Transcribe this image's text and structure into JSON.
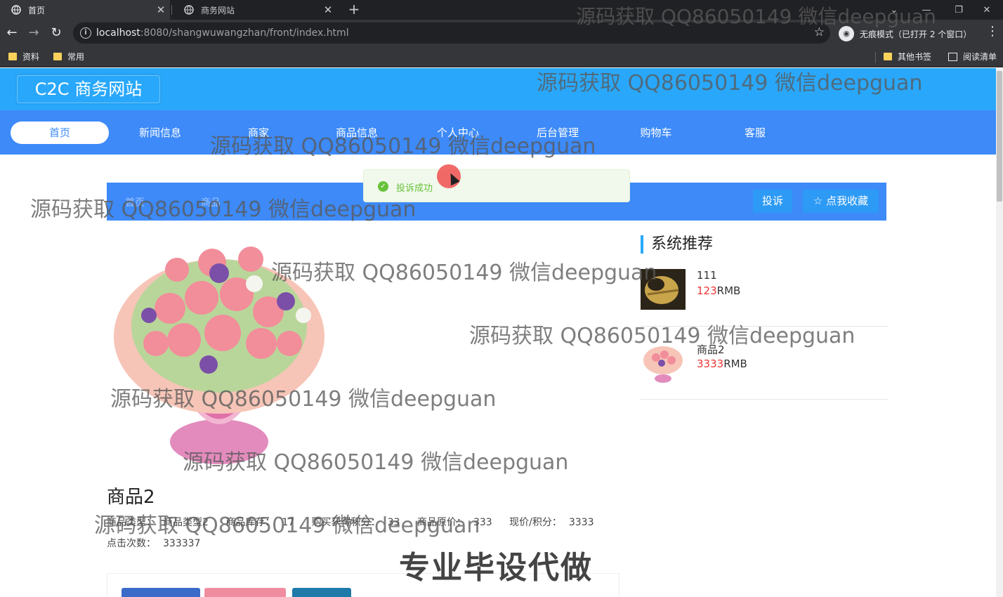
{
  "browser": {
    "tabs": [
      {
        "title": "首页",
        "close": "✕"
      },
      {
        "title": "商务网站",
        "close": "✕"
      }
    ],
    "new_tab": "+",
    "window_controls": [
      "⌄",
      "—",
      "❐",
      "✕"
    ],
    "url_host": "localhost",
    "url_rest": ":8080/shangwuwangzhan/front/index.html",
    "incognito_label": "无痕模式（已打开 2 个窗口）",
    "bookmarks": [
      "资料",
      "常用"
    ],
    "other_bookmarks": "其他书签",
    "reading_list": "阅读清单"
  },
  "site": {
    "logo": "C2C 商务网站",
    "nav": [
      "首页",
      "新闻信息",
      "商家",
      "商品信息",
      "个人中心",
      "后台管理",
      "购物车",
      "客服"
    ],
    "active_nav_index": 0
  },
  "toast": {
    "text": "投诉成功"
  },
  "breadcrumb": [
    "首页",
    "商品"
  ],
  "actions": {
    "complain": "投诉",
    "favorite": "☆ 点我收藏"
  },
  "product": {
    "name": "商品2",
    "fields": [
      {
        "label": "商品类型：",
        "value": "商品类型2"
      },
      {
        "label": "商品库存：",
        "value": "17"
      },
      {
        "label": "购买获得积分：",
        "value": "33"
      },
      {
        "label": "商品原价：",
        "value": "333"
      },
      {
        "label": "现价/积分：",
        "value": "3333"
      }
    ],
    "clicks_label": "点击次数：",
    "clicks_value": "333337"
  },
  "recommend": {
    "title": "系统推荐",
    "items": [
      {
        "name": "111",
        "price": "123",
        "unit": "RMB"
      },
      {
        "name": "商品2",
        "price": "3333",
        "unit": "RMB"
      }
    ]
  },
  "watermarks": {
    "text": "源码获取 QQ86050149 微信deepguan",
    "promo": "专业毕设代做"
  },
  "colors": {
    "header": "#29a8fb",
    "nav": "#3d8af8",
    "success": "#67c23a",
    "price": "#ee3333"
  }
}
